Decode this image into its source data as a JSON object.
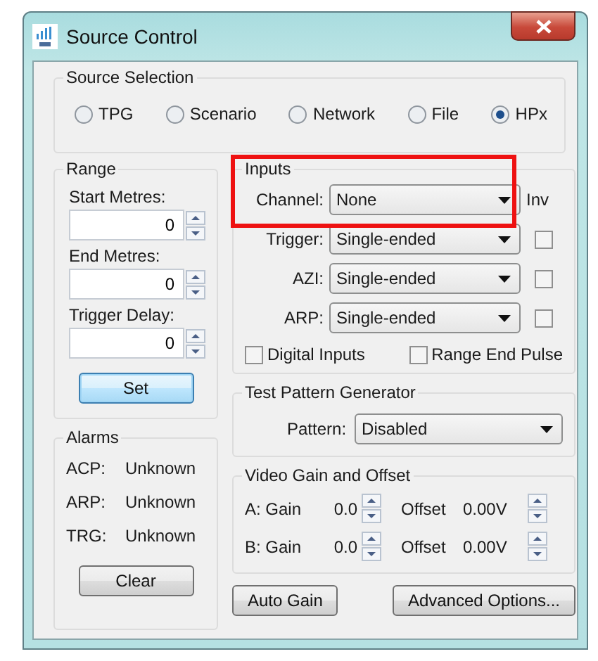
{
  "window": {
    "title": "Source Control"
  },
  "source_selection": {
    "title": "Source Selection",
    "options": [
      {
        "label": "TPG",
        "selected": false
      },
      {
        "label": "Scenario",
        "selected": false
      },
      {
        "label": "Network",
        "selected": false
      },
      {
        "label": "File",
        "selected": false
      },
      {
        "label": "HPx",
        "selected": true
      }
    ]
  },
  "range": {
    "title": "Range",
    "fields": [
      {
        "label": "Start Metres:",
        "value": "0"
      },
      {
        "label": "End Metres:",
        "value": "0"
      },
      {
        "label": "Trigger Delay:",
        "value": "0"
      }
    ],
    "button": {
      "label": "Set",
      "focused": true
    }
  },
  "alarms": {
    "title": "Alarms",
    "items": [
      {
        "name": "ACP:",
        "status": "Unknown"
      },
      {
        "name": "ARP:",
        "status": "Unknown"
      },
      {
        "name": "TRG:",
        "status": "Unknown"
      }
    ],
    "button": {
      "label": "Clear",
      "focused": false
    }
  },
  "inputs": {
    "title": "Inputs",
    "channel": {
      "label": "Channel:",
      "value": "None",
      "highlighted": true
    },
    "inv_label": "Inv",
    "signals": [
      {
        "label": "Trigger:",
        "value": "Single-ended",
        "inverted": false
      },
      {
        "label": "AZI:",
        "value": "Single-ended",
        "inverted": false
      },
      {
        "label": "ARP:",
        "value": "Single-ended",
        "inverted": false
      }
    ],
    "options": [
      {
        "label": "Digital Inputs",
        "checked": false
      },
      {
        "label": "Range End Pulse",
        "checked": false
      }
    ]
  },
  "test_pattern": {
    "title": "Test Pattern Generator",
    "label": "Pattern:",
    "value": "Disabled"
  },
  "video": {
    "title": "Video Gain and Offset",
    "rows": [
      {
        "label": "A: Gain",
        "gain": "0.0",
        "offset_label": "Offset",
        "offset": "0.00V"
      },
      {
        "label": "B: Gain",
        "gain": "0.0",
        "offset_label": "Offset",
        "offset": "0.00V"
      }
    ]
  },
  "buttons": [
    {
      "label": "Auto Gain"
    },
    {
      "label": "Advanced Options..."
    }
  ]
}
